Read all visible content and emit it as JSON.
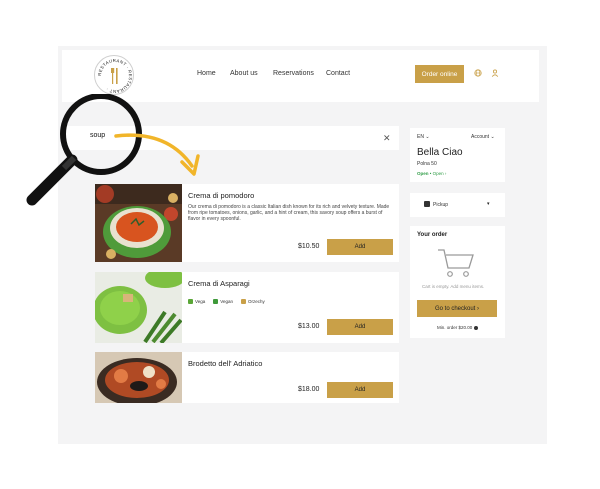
{
  "logo": {
    "ring_text": "RESTAURANT · RESTAURANT ·"
  },
  "nav": {
    "items": [
      "Home",
      "About us",
      "Reservations",
      "Contact"
    ]
  },
  "header": {
    "order_button": "Order online"
  },
  "search": {
    "value": "soup"
  },
  "dishes": [
    {
      "title": "Crema di pomodoro",
      "description": "Our crema di pomodoro is a classic Italian dish known for its rich and velvety texture. Made from ripe tomatoes, onions, garlic, and a hint of cream, this savory soup offers a burst of flavor in every spoonful.",
      "price": "$10.50",
      "add_label": "Add"
    },
    {
      "title": "Crema di Asparagi",
      "tags": [
        "Vega",
        "Vegan",
        "Orzechy"
      ],
      "price": "$13.00",
      "add_label": "Add"
    },
    {
      "title": "Brodetto dell' Adriatico",
      "price": "$18.00",
      "add_label": "Add"
    }
  ],
  "info": {
    "lang": "EN",
    "account": "Account",
    "name": "Bella Ciao",
    "street": "Polna 50",
    "status_open": "Open",
    "status_text": "• Open ›"
  },
  "pickup": {
    "label": "Pickup"
  },
  "order": {
    "title": "Your order",
    "empty_text": "Cart is empty. Add menu items.",
    "checkout": "Go to checkout ›",
    "min_order": "Min. order $20.00"
  },
  "colors": {
    "accent": "#c9a048",
    "open_green": "#2e9c45",
    "arrow": "#f1b52a"
  }
}
